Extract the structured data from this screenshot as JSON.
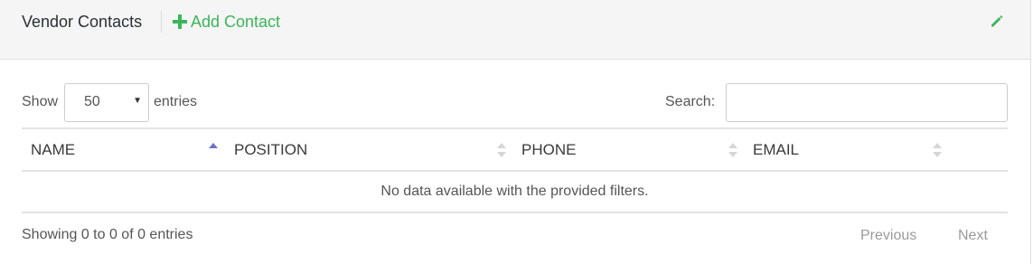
{
  "header": {
    "title": "Vendor Contacts",
    "add_label": "Add Contact",
    "accent_color": "#3cb55a"
  },
  "controls": {
    "show_label": "Show",
    "page_length": "50",
    "entries_label": "entries",
    "search_label": "Search:",
    "search_value": ""
  },
  "table": {
    "columns": [
      {
        "label": "NAME",
        "sort": "ascending"
      },
      {
        "label": "POSITION",
        "sort": "none"
      },
      {
        "label": "PHONE",
        "sort": "none"
      },
      {
        "label": "EMAIL",
        "sort": "none"
      }
    ],
    "empty_message": "No data available with the provided filters."
  },
  "footer": {
    "info": "Showing 0 to 0 of 0 entries",
    "previous_label": "Previous",
    "next_label": "Next"
  }
}
